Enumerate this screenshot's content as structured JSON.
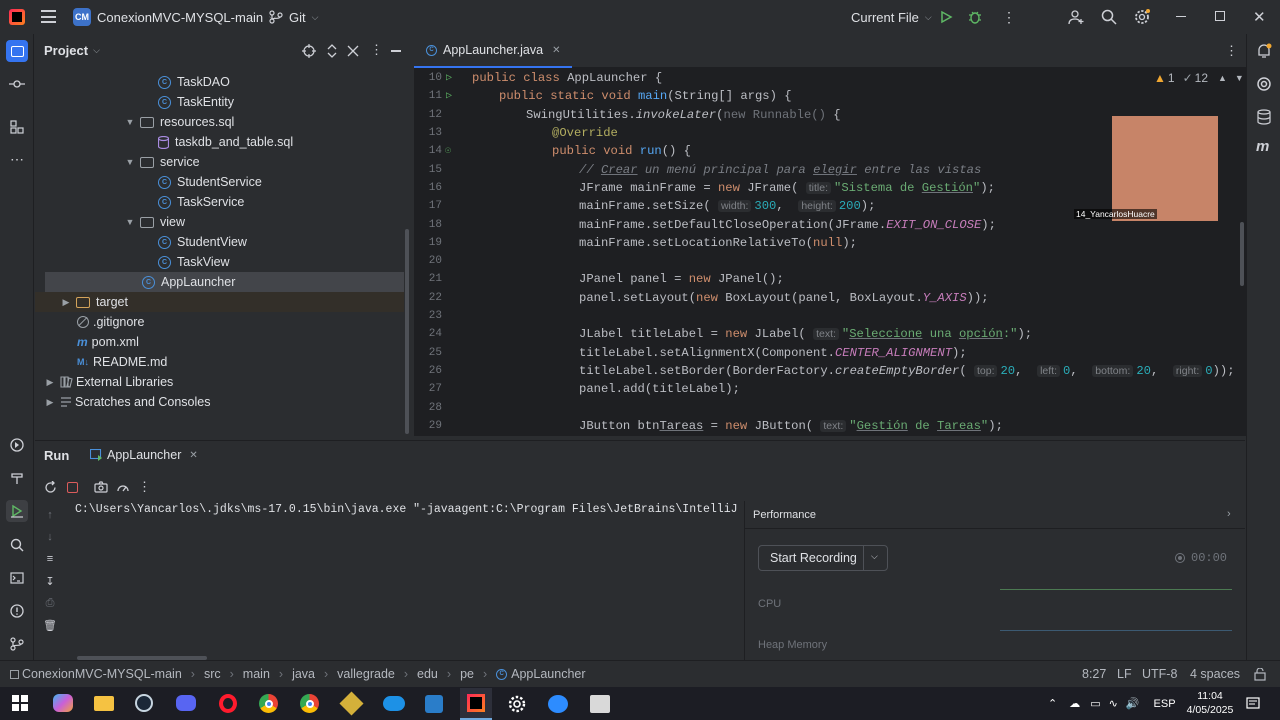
{
  "titlebar": {
    "project_badge": "CM",
    "project_name": "ConexionMVC-MYSQL-main",
    "vcs": "Git",
    "run_config": "Current File"
  },
  "project_panel": {
    "title": "Project",
    "tree": [
      {
        "label": "TaskDAO",
        "kind": "class",
        "indent": 3
      },
      {
        "label": "TaskEntity",
        "kind": "class",
        "indent": 3
      },
      {
        "label": "resources.sql",
        "kind": "folder",
        "indent": 2,
        "expanded": true
      },
      {
        "label": "taskdb_and_table.sql",
        "kind": "sql",
        "indent": 3
      },
      {
        "label": "service",
        "kind": "folder",
        "indent": 2,
        "expanded": true
      },
      {
        "label": "StudentService",
        "kind": "class",
        "indent": 3
      },
      {
        "label": "TaskService",
        "kind": "class",
        "indent": 3
      },
      {
        "label": "view",
        "kind": "folder",
        "indent": 2,
        "expanded": true
      },
      {
        "label": "StudentView",
        "kind": "class",
        "indent": 3
      },
      {
        "label": "TaskView",
        "kind": "class",
        "indent": 3
      },
      {
        "label": "AppLauncher",
        "kind": "class",
        "indent": 2,
        "selected": true
      },
      {
        "label": "target",
        "kind": "folder-orange",
        "indent": 1,
        "expanded": false
      },
      {
        "label": ".gitignore",
        "kind": "ignore",
        "indent": 1
      },
      {
        "label": "pom.xml",
        "kind": "maven",
        "indent": 1
      },
      {
        "label": "README.md",
        "kind": "md",
        "indent": 1
      },
      {
        "label": "External Libraries",
        "kind": "lib",
        "indent": 0,
        "expanded": false
      },
      {
        "label": "Scratches and Consoles",
        "kind": "scratch",
        "indent": 0,
        "expanded": false
      }
    ]
  },
  "editor": {
    "tab": "AppLauncher.java",
    "warnings": "1",
    "weak_warnings": "12",
    "lines": [
      "10",
      "11",
      "12",
      "13",
      "14",
      "15",
      "16",
      "17",
      "18",
      "19",
      "20",
      "21",
      "22",
      "23",
      "24",
      "25",
      "26",
      "27",
      "28",
      "29"
    ],
    "webcam_label": "14_YancarlosHuacre"
  },
  "run_panel": {
    "title": "Run",
    "tab": "AppLauncher",
    "console_line": "C:\\Users\\Yancarlos\\.jdks\\ms-17.0.15\\bin\\java.exe \"-javaagent:C:\\Program Files\\JetBrains\\IntelliJ IDE",
    "performance": {
      "title": "Performance",
      "record_button": "Start Recording",
      "timer": "00:00",
      "cpu_label": "CPU",
      "heap_label": "Heap Memory"
    }
  },
  "statusbar": {
    "breadcrumb": [
      "ConexionMVC-MYSQL-main",
      "src",
      "main",
      "java",
      "vallegrade",
      "edu",
      "pe",
      "AppLauncher"
    ],
    "position": "8:27",
    "line_sep": "LF",
    "encoding": "UTF-8",
    "indent": "4 spaces"
  },
  "taskbar": {
    "lang": "ESP",
    "time": "11:04",
    "date": "4/05/2025"
  },
  "colors": {
    "bg": "#2b2d30",
    "editor_bg": "#1e1f22",
    "keyword": "#cf8e6d",
    "string": "#6aab73",
    "accent": "#3574f0"
  }
}
